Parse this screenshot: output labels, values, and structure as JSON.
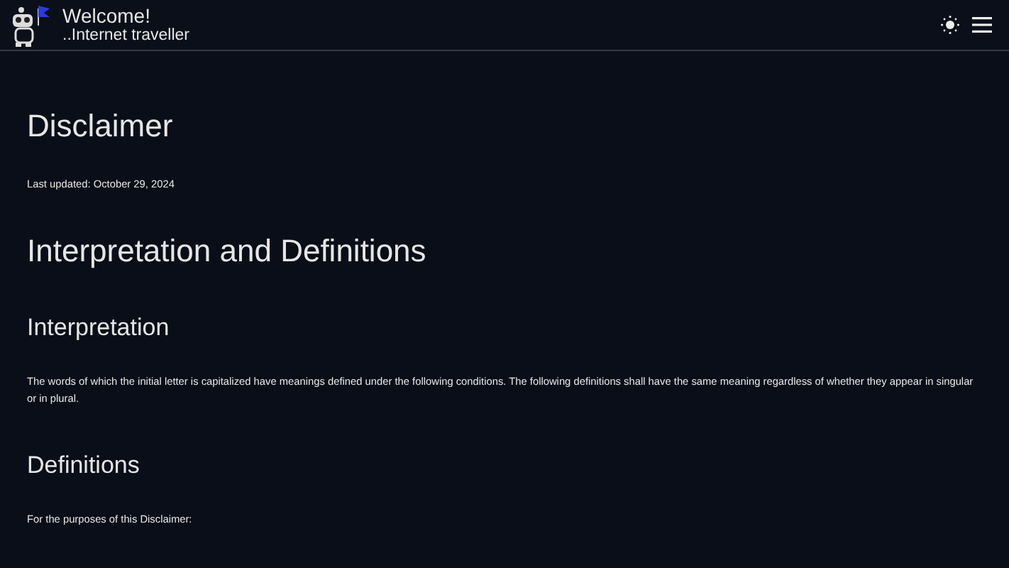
{
  "header": {
    "title": "Welcome!",
    "subtitle": "..Internet traveller"
  },
  "content": [
    {
      "kind": "h1",
      "text": "Disclaimer"
    },
    {
      "kind": "p",
      "text": "Last updated: October 29, 2024"
    },
    {
      "kind": "h1",
      "text": "Interpretation and Definitions"
    },
    {
      "kind": "h2",
      "text": "Interpretation"
    },
    {
      "kind": "p",
      "text": "The words of which the initial letter is capitalized have meanings defined under the following conditions. The following definitions shall have the same meaning regardless of whether they appear in singular or in plural."
    },
    {
      "kind": "h2",
      "text": "Definitions"
    },
    {
      "kind": "p",
      "text": "For the purposes of this Disclaimer:"
    }
  ]
}
